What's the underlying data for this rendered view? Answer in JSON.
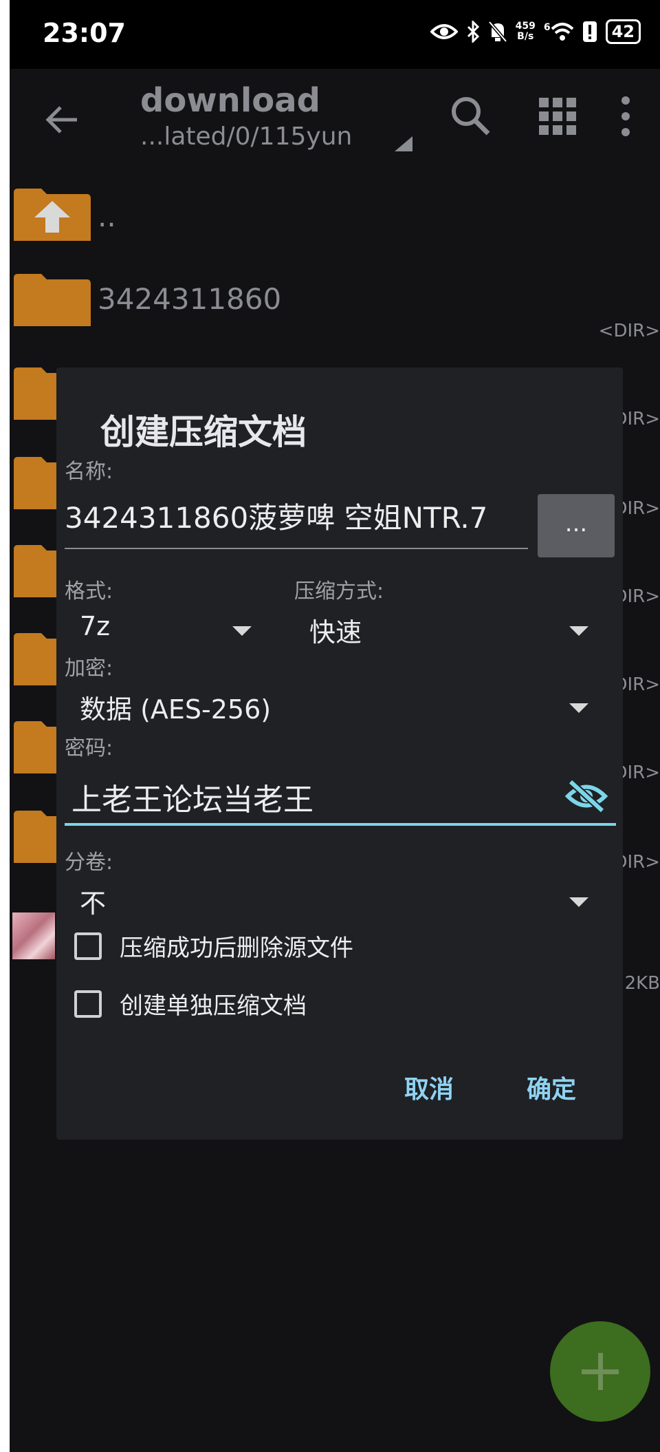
{
  "status_bar": {
    "time": "23:07",
    "net_speed_value": "459",
    "net_speed_unit": "B/s",
    "wifi_badge": "6",
    "battery": "42"
  },
  "toolbar": {
    "title": "download",
    "path": "...lated/0/115yun"
  },
  "files": [
    {
      "name": "..",
      "tag": ""
    },
    {
      "name": "3424311860",
      "tag": "<DIR>"
    },
    {
      "name": "",
      "tag": "DIR>"
    },
    {
      "name": "",
      "tag": "DIR>"
    },
    {
      "name": "",
      "tag": "DIR>"
    },
    {
      "name": "",
      "tag": "DIR>"
    },
    {
      "name": "",
      "tag": "DIR>"
    },
    {
      "name": "",
      "tag": "DIR>"
    },
    {
      "name": "",
      "tag": "2KB"
    }
  ],
  "dialog": {
    "title": "创建压缩文档",
    "name_label": "名称:",
    "name_value": "3424311860菠萝啤 空姐NTR.7",
    "browse_label": "...",
    "format_label": "格式:",
    "format_value": "7z",
    "method_label": "压缩方式:",
    "method_value": "快速",
    "encryption_label": "加密:",
    "encryption_value": "数据 (AES-256)",
    "password_label": "密码:",
    "password_value": "上老王论坛当老王",
    "split_label": "分卷:",
    "split_value": "不",
    "delete_source_label": "压缩成功后删除源文件",
    "separate_archives_label": "创建单独压缩文档",
    "cancel_label": "取消",
    "ok_label": "确定"
  },
  "colors": {
    "accent": "#8fd3f2",
    "folder": "#c47a1f",
    "fab": "#3d6d1e"
  }
}
